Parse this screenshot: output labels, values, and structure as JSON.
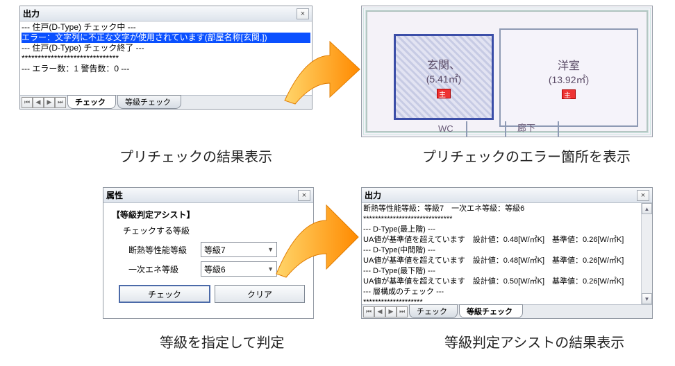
{
  "panel1": {
    "title": "出力",
    "lines": [
      "--- 住戸(D-Type) チェック中 ---",
      "エラー：文字列に不正な文字が使用されています(部屋名称[玄関,])",
      "--- 住戸(D-Type) チェック終了 ---",
      "******************************",
      "--- エラー数：1 警告数：0 ---"
    ],
    "selected_index": 1,
    "tabs": {
      "tab1": "チェック",
      "tab2": "等級チェック"
    }
  },
  "floorplan": {
    "room1": {
      "name": "玄関、",
      "area": "(5.41㎡)"
    },
    "room2": {
      "name": "洋室",
      "area": "(13.92㎡)"
    },
    "bottom1": "WC",
    "bottom2": "廊下"
  },
  "caption1": "プリチェックの結果表示",
  "caption2": "プリチェックのエラー箇所を表示",
  "prop": {
    "title": "属性",
    "group": "【等級判定アシスト】",
    "check_label": "チェックする等級",
    "row1_label": "断熱等性能等級",
    "row1_value": "等級7",
    "row2_label": "一次エネ等級",
    "row2_value": "等級6",
    "check_btn": "チェック",
    "clear_btn": "クリア"
  },
  "panel3": {
    "title": "出力",
    "lines": [
      "断熱等性能等級：等級7　一次エネ等級：等級6",
      "******************************",
      "--- D-Type(最上階) ---",
      "UA値が基準値を超えています　設計値：0.48[W/㎡K]　基準値：0.26[W/㎡K]",
      "--- D-Type(中間階) ---",
      "UA値が基準値を超えています　設計値：0.48[W/㎡K]　基準値：0.26[W/㎡K]",
      "--- D-Type(最下階) ---",
      "UA値が基準値を超えています　設計値：0.50[W/㎡K]　基準値：0.26[W/㎡K]",
      "--- 層構成のチェック ---",
      "********************"
    ],
    "tabs": {
      "tab1": "チェック",
      "tab2": "等級チェック"
    }
  },
  "caption3": "等級を指定して判定",
  "caption4": "等級判定アシストの結果表示"
}
